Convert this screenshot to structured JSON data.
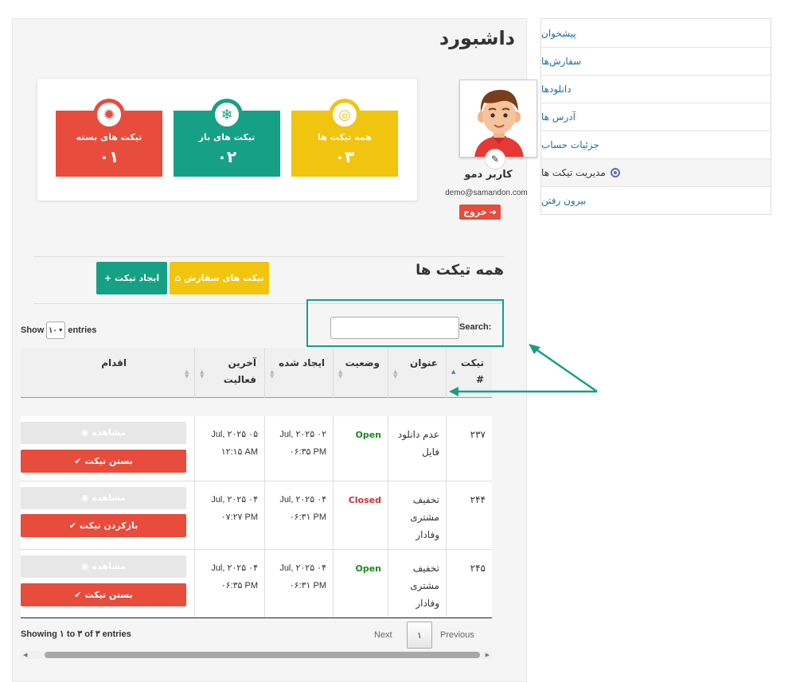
{
  "nav": {
    "items": [
      {
        "label": "پیشخوان"
      },
      {
        "label": "سفارش‌ها"
      },
      {
        "label": "دانلودها"
      },
      {
        "label": "آدرس ها"
      },
      {
        "label": "جزئیات حساب"
      },
      {
        "label": "مدیریت تیکت ها",
        "active": true
      },
      {
        "label": "بیرون رفتن"
      }
    ]
  },
  "page": {
    "title": "داشبورد"
  },
  "user": {
    "name": "کاربر دمو",
    "email": "demo@samandon.com",
    "logout": "خروج"
  },
  "stats": [
    {
      "label": "تیکت های بسته",
      "value": "۰۱",
      "color": "#e74c3c"
    },
    {
      "label": "تیکت های باز",
      "value": "۰۲",
      "color": "#16a085"
    },
    {
      "label": "همه تیکت ها",
      "value": "۰۳",
      "color": "#f1c40f"
    }
  ],
  "section": {
    "title": "همه تیکت ها",
    "create_label": "ایجاد تیکت",
    "orders_label": "تیکت های سفارش"
  },
  "controls": {
    "show": "Show",
    "length": "۱۰",
    "entries": "entries",
    "search": "Search:"
  },
  "table": {
    "headers": {
      "id": "تیکت",
      "id_hash": "#",
      "title": "عنوان",
      "status": "وضعیت",
      "created": "ایجاد شده",
      "activity_1": "آخرین",
      "activity_2": "فعالیت",
      "action": "اقدام"
    },
    "view_label": "مشاهده",
    "rows": [
      {
        "id": "۲۳۷",
        "title_1": "عدم دانلود",
        "title_2": "فایل",
        "title_3": "",
        "status": "Open",
        "created_1": "Jul, ۲۰۲۵ ۰۲",
        "created_2": "۰۶:۳۵ PM",
        "activity_1": "Jul, ۲۰۲۵ ۰۵",
        "activity_2": "۱۲:۱۵ AM",
        "action": "بستن تیکت"
      },
      {
        "id": "۲۴۴",
        "title_1": "تخفیف",
        "title_2": "مشتری",
        "title_3": "وفادار",
        "status": "Closed",
        "created_1": "Jul, ۲۰۲۵ ۰۴",
        "created_2": "۰۶:۳۱ PM",
        "activity_1": "Jul, ۲۰۲۵ ۰۴",
        "activity_2": "۰۷:۲۷ PM",
        "action": "بازکردن تیکت"
      },
      {
        "id": "۲۴۵",
        "title_1": "تخفیف",
        "title_2": "مشتری",
        "title_3": "وفادار",
        "status": "Open",
        "created_1": "Jul, ۲۰۲۵ ۰۴",
        "created_2": "۰۶:۳۱ PM",
        "activity_1": "Jul, ۲۰۲۵ ۰۴",
        "activity_2": "۰۶:۳۵ PM",
        "action": "بستن تیکت"
      }
    ]
  },
  "footer": {
    "info": "Showing ۱ to ۳ of ۳ entries",
    "previous": "Previous",
    "page": "۱",
    "next": "Next"
  },
  "colors": {
    "accent": "#16a085",
    "danger": "#e74c3c",
    "warning": "#f1c40f",
    "link": "#1f6fa3"
  }
}
